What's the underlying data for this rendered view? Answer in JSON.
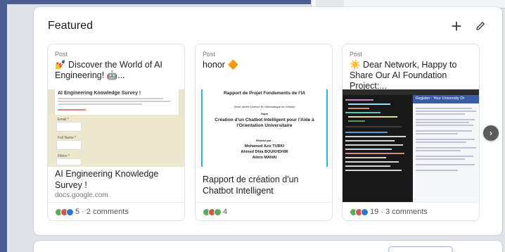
{
  "featured": {
    "title": "Featured",
    "add_icon": "plus-icon",
    "edit_icon": "pencil-icon",
    "items": [
      {
        "type": "Post",
        "title": "💅 Discover the World of AI Engineering! 🤖...",
        "caption": "AI Engineering Knowledge Survey !",
        "source": "docs.google.com",
        "reactions": "5 · 2 comments",
        "thumb": {
          "doc_title": "AI Engineering Knowledge Survey !",
          "labels": [
            "Email *",
            "Full Name *",
            "Filière *"
          ]
        }
      },
      {
        "type": "Post",
        "title": "honor 🔶",
        "caption": "Rapport de création d'un Chatbot Intelligent",
        "source": "",
        "reactions": "4",
        "thumb": {
          "heading": "Rapport de Projet Fondements de l'IA",
          "sub": "2ème année Licence En Informatique de Gestion",
          "sujet": "Sujet",
          "main": "Création d'un Chatbot Intelligent pour l'Aide à l'Orientation Universitaire",
          "by": "Réalisé par :",
          "names": [
            "Mohamed Aziz TURKI",
            "Ahmed Dhia BOUKHDHIR",
            "Adem MANAI"
          ]
        }
      },
      {
        "type": "Post",
        "title": "☀️ Dear Network, Happy to Share Our AI Foundation Project:...",
        "caption": "",
        "source": "",
        "reactions": "19 · 3 comments",
        "thumb": {
          "doc_head": "Register : Your University Or"
        }
      }
    ]
  },
  "colors": {
    "frame": "#4b5e93",
    "reaction_green": "#5bab5b",
    "reaction_red": "#d9534f",
    "reaction_blue": "#2a78c9",
    "report_accent": "#28b6d6"
  }
}
